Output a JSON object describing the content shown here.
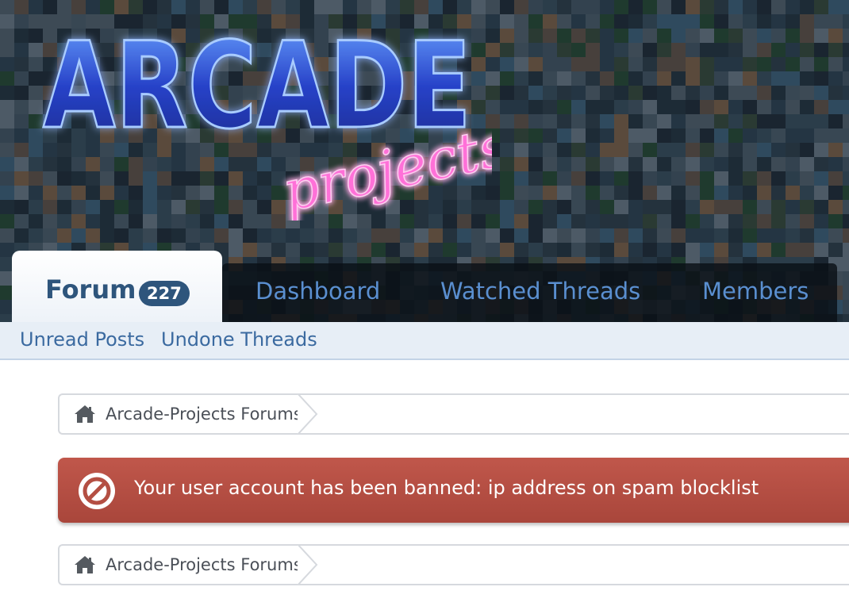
{
  "header": {
    "logo_main": "ARCADE",
    "logo_sub": "projects"
  },
  "nav": {
    "tabs": [
      {
        "label": "Forum",
        "badge": "227",
        "active": true
      },
      {
        "label": "Dashboard"
      },
      {
        "label": "Watched Threads"
      },
      {
        "label": "Members"
      }
    ]
  },
  "subnav": {
    "items": [
      {
        "label": "Unread Posts"
      },
      {
        "label": "Undone Threads"
      }
    ]
  },
  "breadcrumb_top": {
    "label": "Arcade-Projects Forums",
    "icon": "home-icon"
  },
  "error": {
    "message": "Your user account has been banned: ip address on spam blocklist",
    "icon": "ban-icon"
  },
  "breadcrumb_bottom": {
    "label": "Arcade-Projects Forums",
    "icon": "home-icon"
  },
  "colors": {
    "tab_text": "#5a8fd0",
    "active_tab_text": "#2e557c",
    "badge_bg": "#2e557c",
    "subnav_text": "#3b6aa0",
    "error_bg": "#b44f43",
    "logo_blue": "#3f6cff",
    "logo_pink": "#ff3fc8"
  }
}
